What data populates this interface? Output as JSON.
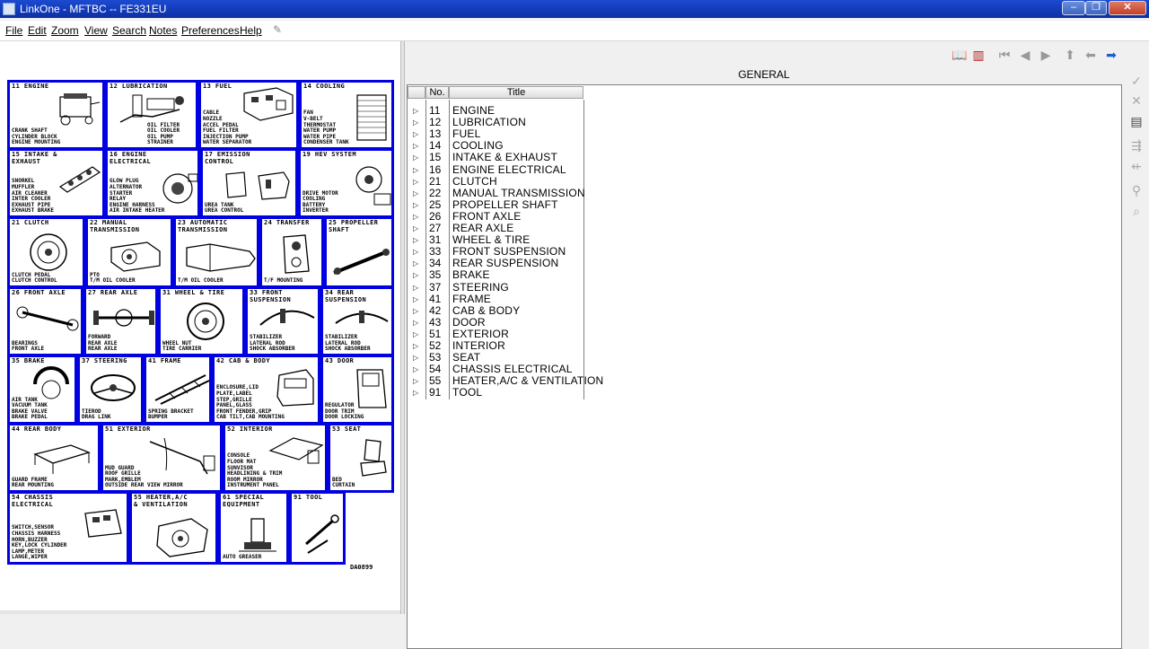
{
  "window": {
    "title": "LinkOne - MFTBC -- FE331EU",
    "minimize": "–",
    "restore": "❐",
    "close": "✕"
  },
  "menu": [
    "File",
    "Edit",
    "Zoom",
    "View",
    "Search",
    "Notes",
    "Preferences",
    "Help"
  ],
  "diagram": {
    "code": "DA0899",
    "cells": [
      {
        "header": "11 ENGINE",
        "subs": "CRANK SHAFT\nCYLINDER BLOCK\nENGINE MOUNTING"
      },
      {
        "header": "12 LUBRICATION",
        "subs": "OIL FILTER\nOIL COOLER\nOIL PUMP\nSTRAINER"
      },
      {
        "header": "13 FUEL",
        "subs": "CABLE\nNOZZLE\nACCEL PEDAL\nFUEL FILTER\nINJECTION PUMP\nWATER SEPARATOR"
      },
      {
        "header": "14 COOLING",
        "subs": "FAN\nV-BELT\nTHERMOSTAT\nWATER PUMP\nWATER PIPE\nCONDENSER TANK"
      },
      {
        "header": "15 INTAKE &\n   EXHAUST",
        "subs": "SNORKEL\nMUFFLER\nAIR CLEANER\nINTER COOLER\nEXHAUST PIPE\nEXHAUST BRAKE"
      },
      {
        "header": "16 ENGINE\n   ELECTRICAL",
        "subs": "GLOW PLUG\nALTERNATOR\nSTARTER\nRELAY\nENGINE HARNESS\nAIR INTAKE HEATER"
      },
      {
        "header": "17 EMISSION\n   CONTROL",
        "subs": "UREA TANK\nUREA CONTROL"
      },
      {
        "header": "19 HEV SYSTEM",
        "subs": "DRIVE MOTOR\nCOOLING\nBATTERY\nINVERTER"
      },
      {
        "header": "21 CLUTCH",
        "subs": "CLUTCH PEDAL\nCLUTCH CONTROL"
      },
      {
        "header": "22 MANUAL\n   TRANSMISSION",
        "subs": "PTO\nT/M OIL COOLER"
      },
      {
        "header": "23 AUTOMATIC\n   TRANSMISSION",
        "subs": "T/M OIL COOLER"
      },
      {
        "header": "24 TRANSFER",
        "subs": "T/F MOUNTING"
      },
      {
        "header": "25 PROPELLER\n   SHAFT",
        "subs": ""
      },
      {
        "header": "26 FRONT AXLE",
        "subs": "BEARINGS\nFRONT AXLE"
      },
      {
        "header": "27 REAR AXLE",
        "subs": "FORWARD\nREAR AXLE\nREAR AXLE"
      },
      {
        "header": "31 WHEEL & TIRE",
        "subs": "WHEEL NUT\nTIRE CARRIER"
      },
      {
        "header": "33 FRONT\n   SUSPENSION",
        "subs": "STABILIZER\nLATERAL ROD\nSHOCK ABSORBER"
      },
      {
        "header": "34 REAR\n   SUSPENSION",
        "subs": "STABILIZER\nLATERAL ROD\nSHOCK ABSORBER"
      },
      {
        "header": "35 BRAKE",
        "subs": "AIR TANK\nVACUUM TANK\nBRAKE VALVE\nBRAKE PEDAL"
      },
      {
        "header": "37 STEERING",
        "subs": "TIEROD\nDRAG LINK"
      },
      {
        "header": "41 FRAME",
        "subs": "SPRING BRACKET\nBUMPER"
      },
      {
        "header": "42 CAB & BODY",
        "subs": "ENCLOSURE,LID\nPLATE,LABEL\nSTEP,GRILLE\nPANEL,GLASS\nFRONT FENDER,GRIP\nCAB TILT,CAB MOUNTING"
      },
      {
        "header": "43 DOOR",
        "subs": "REGULATOR\nDOOR TRIM\nDOOR LOCKING"
      },
      {
        "header": "44 REAR BODY",
        "subs": "GUARD FRAME\nREAR MOUNTING"
      },
      {
        "header": "51 EXTERIOR",
        "subs": "MUD GUARD\nROOF GRILLE\nMARK,EMBLEM\nOUTSIDE REAR VIEW MIRROR"
      },
      {
        "header": "52 INTERIOR",
        "subs": "CONSOLE\nFLOOR MAT\nSUNVISOR\nHEADLINING & TRIM\nROOM MIRROR\nINSTRUMENT PANEL"
      },
      {
        "header": "53 SEAT",
        "subs": "BED\nCURTAIN"
      },
      {
        "header": "54 CHASSIS\n   ELECTRICAL",
        "subs": "SWITCH,SENSOR\nCHASSIS HARNESS\nHORN,BUZZER\nKEY,LOCK CYLINDER\nLAMP,METER\nLANGE,WIPER"
      },
      {
        "header": "55 HEATER,A/C\n   & VENTILATION",
        "subs": ""
      },
      {
        "header": "61 SPECIAL\n   EQUIPMENT",
        "subs": "AUTO GREASER"
      },
      {
        "header": "91 TOOL",
        "subs": ""
      }
    ]
  },
  "right": {
    "section_title": "GENERAL",
    "columns": {
      "no": "No.",
      "title": "Title"
    },
    "rows": [
      {
        "no": "11",
        "title": "ENGINE"
      },
      {
        "no": "12",
        "title": "LUBRICATION"
      },
      {
        "no": "13",
        "title": "FUEL"
      },
      {
        "no": "14",
        "title": "COOLING"
      },
      {
        "no": "15",
        "title": "INTAKE & EXHAUST"
      },
      {
        "no": "16",
        "title": "ENGINE ELECTRICAL"
      },
      {
        "no": "21",
        "title": "CLUTCH"
      },
      {
        "no": "22",
        "title": "MANUAL TRANSMISSION"
      },
      {
        "no": "25",
        "title": "PROPELLER SHAFT"
      },
      {
        "no": "26",
        "title": "FRONT AXLE"
      },
      {
        "no": "27",
        "title": "REAR AXLE"
      },
      {
        "no": "31",
        "title": "WHEEL & TIRE"
      },
      {
        "no": "33",
        "title": "FRONT SUSPENSION"
      },
      {
        "no": "34",
        "title": "REAR SUSPENSION"
      },
      {
        "no": "35",
        "title": "BRAKE"
      },
      {
        "no": "37",
        "title": "STEERING"
      },
      {
        "no": "41",
        "title": "FRAME"
      },
      {
        "no": "42",
        "title": "CAB & BODY"
      },
      {
        "no": "43",
        "title": "DOOR"
      },
      {
        "no": "51",
        "title": "EXTERIOR"
      },
      {
        "no": "52",
        "title": "INTERIOR"
      },
      {
        "no": "53",
        "title": "SEAT"
      },
      {
        "no": "54",
        "title": "CHASSIS ELECTRICAL"
      },
      {
        "no": "55",
        "title": "HEATER,A/C & VENTILATION"
      },
      {
        "no": "91",
        "title": "TOOL"
      }
    ]
  },
  "colors": {
    "diagram_border": "#0000e0",
    "titlebar": "#1c4ad0"
  }
}
